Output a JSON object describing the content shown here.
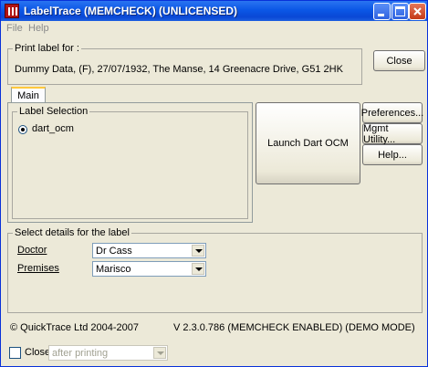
{
  "window": {
    "title": "LabelTrace (MEMCHECK) (UNLICENSED)"
  },
  "menu": [
    "File",
    "Help"
  ],
  "print_label": {
    "legend": "Print label for :",
    "value": "Dummy Data, (F), 27/07/1932, The Manse, 14 Greenacre Drive, G51 2HK"
  },
  "close_button": "Close",
  "tabs": [
    {
      "label": "Main"
    }
  ],
  "label_selection": {
    "legend": "Label Selection",
    "options": [
      {
        "label": "dart_ocm",
        "selected": true
      }
    ]
  },
  "launch_button": "Launch Dart OCM",
  "side_buttons": {
    "preferences": "Preferences...",
    "mgmt": "Mgmt Utility...",
    "help": "Help..."
  },
  "details": {
    "legend": "Select details for the label",
    "doctor_label": "Doctor",
    "doctor_value": "Dr Cass",
    "premises_label": "Premises",
    "premises_value": "Marisco"
  },
  "footer": {
    "copyright": "© QuickTrace Ltd 2004-2007",
    "version": "V 2.3.0.786 (MEMCHECK ENABLED)  (DEMO MODE)"
  },
  "bottom": {
    "close_check_label": "Close",
    "close_check_checked": false,
    "after_select_value": "after printing"
  },
  "colors": {
    "title_bar": "#0b57e6",
    "window_face": "#ece9d8",
    "close_button": "#c43a18"
  }
}
